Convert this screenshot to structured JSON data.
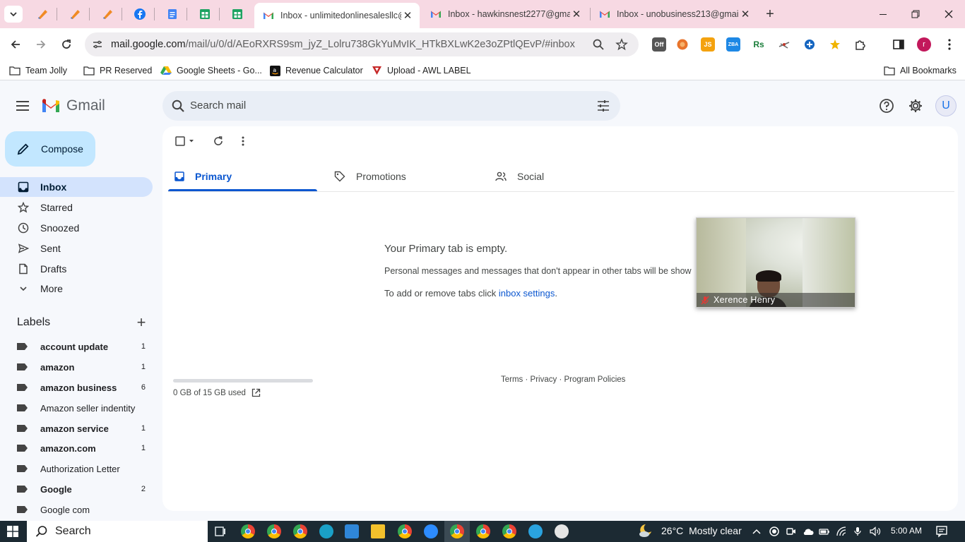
{
  "browser": {
    "tabs": [
      {
        "title": "Inbox - unlimitedonlinesalesllc@",
        "active": true
      },
      {
        "title": "Inbox - hawkinsnest2277@gma",
        "active": false
      },
      {
        "title": "Inbox - unobusiness213@gmail",
        "active": false
      }
    ],
    "url_host": "mail.google.com",
    "url_path": "/mail/u/0/d/AEoRXRS9sm_jyZ_Lolru738GkYuMvIK_HTkBXLwK2e3oZPtlQEvP/#inbox",
    "extensions": [
      {
        "name": "off-extension-icon",
        "text": "Off",
        "color": "#555555"
      },
      {
        "name": "orange-extension-icon",
        "text": "",
        "color": "#e8742b"
      },
      {
        "name": "js-extension-icon",
        "text": "JS",
        "color": "#f4a20f"
      },
      {
        "name": "zba-extension-icon",
        "text": "ZBA",
        "color": "#1e88e5"
      },
      {
        "name": "rs-extension-icon",
        "text": "Rs",
        "color": "#1b7e3b"
      },
      {
        "name": "tool-extension-icon",
        "text": "",
        "color": "#6b6b6b"
      },
      {
        "name": "blue-extension-icon",
        "text": "",
        "color": "#1565c0"
      },
      {
        "name": "star-extension-icon",
        "text": "",
        "color": "#f0b400"
      }
    ],
    "profile_initial": "r",
    "bookmarks": [
      {
        "label": "Team Jolly",
        "icon": "folder-icon"
      },
      {
        "label": "PR Reserved",
        "icon": "folder-icon"
      },
      {
        "label": "Google Sheets - Go...",
        "icon": "drive-icon"
      },
      {
        "label": "Revenue Calculator",
        "icon": "amazon-icon"
      },
      {
        "label": "Upload - AWL LABEL",
        "icon": "awl-icon"
      }
    ],
    "all_bookmarks": "All Bookmarks"
  },
  "gmail": {
    "logo_text": "Gmail",
    "search_placeholder": "Search mail",
    "avatar_initial": "U",
    "compose_label": "Compose",
    "nav": [
      {
        "label": "Inbox",
        "icon": "inbox-icon",
        "active": true
      },
      {
        "label": "Starred",
        "icon": "star-icon",
        "active": false
      },
      {
        "label": "Snoozed",
        "icon": "clock-icon",
        "active": false
      },
      {
        "label": "Sent",
        "icon": "send-icon",
        "active": false
      },
      {
        "label": "Drafts",
        "icon": "draft-icon",
        "active": false
      },
      {
        "label": "More",
        "icon": "chevron-down-icon",
        "active": false
      }
    ],
    "labels_heading": "Labels",
    "labels": [
      {
        "name": "account update",
        "count": "1",
        "bold": true
      },
      {
        "name": "amazon",
        "count": "1",
        "bold": true
      },
      {
        "name": "amazon business",
        "count": "6",
        "bold": true
      },
      {
        "name": "Amazon seller indentity",
        "count": "",
        "bold": false
      },
      {
        "name": "amazon service",
        "count": "1",
        "bold": true
      },
      {
        "name": "amazon.com",
        "count": "1",
        "bold": true
      },
      {
        "name": "Authorization Letter",
        "count": "",
        "bold": false
      },
      {
        "name": "Google",
        "count": "2",
        "bold": true
      },
      {
        "name": "Google com",
        "count": "",
        "bold": false
      }
    ],
    "category_tabs": [
      {
        "label": "Primary",
        "icon": "inbox-icon",
        "active": true
      },
      {
        "label": "Promotions",
        "icon": "tag-icon",
        "active": false
      },
      {
        "label": "Social",
        "icon": "people-icon",
        "active": false
      }
    ],
    "empty": {
      "title": "Your Primary tab is empty.",
      "description": "Personal messages and messages that don't appear in other tabs will be show",
      "settings_prefix": "To add or remove tabs click ",
      "settings_link": "inbox settings",
      "settings_suffix": "."
    },
    "storage": {
      "text": "0 GB of 15 GB used",
      "used_fraction": 0.0
    },
    "footer": {
      "terms": "Terms",
      "privacy": "Privacy",
      "policies": "Program Policies",
      "sep": " · "
    }
  },
  "video_call": {
    "participant_name": "Xerence Henry",
    "muted": true
  },
  "taskbar": {
    "search_label": "Search",
    "apps": [
      {
        "name": "task-view-icon",
        "color": "#dfe6ea"
      },
      {
        "name": "chrome-icon",
        "color": "#e8453c"
      },
      {
        "name": "chrome-icon",
        "color": "#e8453c"
      },
      {
        "name": "chrome-icon",
        "color": "#e8453c"
      },
      {
        "name": "edge-icon",
        "color": "#1aa0c7"
      },
      {
        "name": "store-icon",
        "color": "#2f86d8"
      },
      {
        "name": "file-explorer-icon",
        "color": "#f3c12c"
      },
      {
        "name": "chrome-icon",
        "color": "#e8453c"
      },
      {
        "name": "zoom-icon",
        "color": "#2d8cff"
      },
      {
        "name": "chrome-icon",
        "color": "#e8453c"
      },
      {
        "name": "chrome-icon",
        "color": "#e8453c"
      },
      {
        "name": "chrome-icon",
        "color": "#e8453c"
      },
      {
        "name": "telegram-icon",
        "color": "#2aa3df"
      },
      {
        "name": "slack-icon",
        "color": "#e5e5e5"
      }
    ],
    "weather_temp": "26°C",
    "weather_text": "Mostly clear",
    "time": "5:00 AM"
  }
}
